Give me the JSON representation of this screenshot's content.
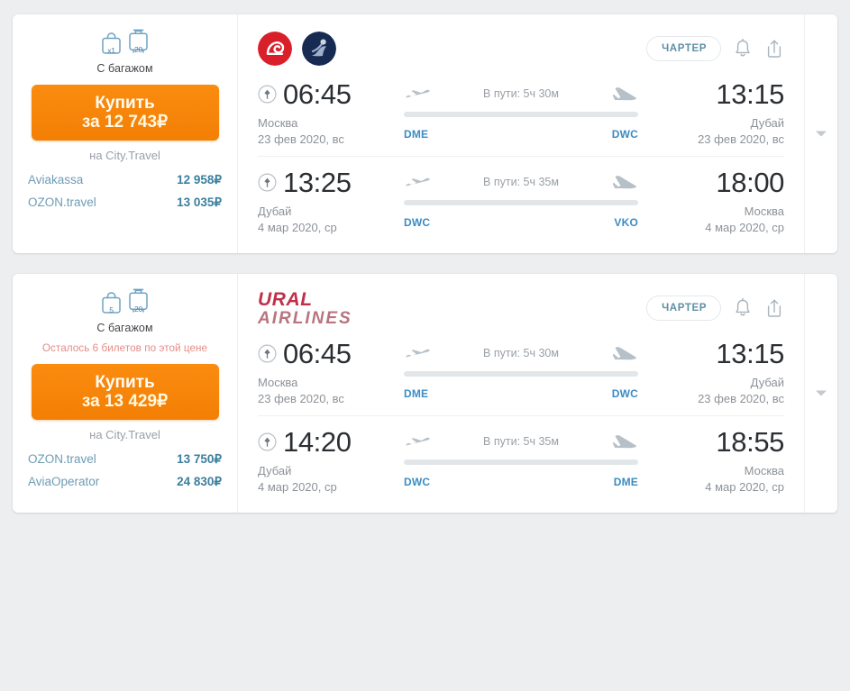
{
  "cards": [
    {
      "baggage": {
        "handbag_label": "x1",
        "suitcase_label": "20",
        "caption": "С багажом"
      },
      "tickets_left": "",
      "buy": {
        "line1": "Купить",
        "line2": "за 12 743₽",
        "sub": "на City.Travel"
      },
      "agencies": [
        {
          "name": "Aviakassa",
          "price": "12 958₽"
        },
        {
          "name": "OZON.travel",
          "price": "13 035₽"
        }
      ],
      "carrier": {
        "type": "circles",
        "logo1_name": "nordwind-airlines-logo",
        "logo2_name": "ikar-airlines-logo"
      },
      "badge": "ЧАРТЕР",
      "segments": [
        {
          "dep_time": "06:45",
          "dep_city": "Москва",
          "dep_date": "23 фев 2020, вс",
          "dep_code": "DME",
          "duration": "В пути: 5ч 30м",
          "arr_time": "13:15",
          "arr_city": "Дубай",
          "arr_date": "23 фев 2020, вс",
          "arr_code": "DWC"
        },
        {
          "dep_time": "13:25",
          "dep_city": "Дубай",
          "dep_date": "4 мар 2020, ср",
          "dep_code": "DWC",
          "duration": "В пути: 5ч 35м",
          "arr_time": "18:00",
          "arr_city": "Москва",
          "arr_date": "4 мар 2020, ср",
          "arr_code": "VKO"
        }
      ]
    },
    {
      "baggage": {
        "handbag_label": "5",
        "suitcase_label": "20",
        "caption": "С багажом"
      },
      "tickets_left": "Осталось 6 билетов по этой цене",
      "buy": {
        "line1": "Купить",
        "line2": "за 13 429₽",
        "sub": "на City.Travel"
      },
      "agencies": [
        {
          "name": "OZON.travel",
          "price": "13 750₽"
        },
        {
          "name": "AviaOperator",
          "price": "24 830₽"
        }
      ],
      "carrier": {
        "type": "ural",
        "ural_line1": "URAL",
        "ural_line2": "AIRLINES"
      },
      "badge": "ЧАРТЕР",
      "segments": [
        {
          "dep_time": "06:45",
          "dep_city": "Москва",
          "dep_date": "23 фев 2020, вс",
          "dep_code": "DME",
          "duration": "В пути: 5ч 30м",
          "arr_time": "13:15",
          "arr_city": "Дубай",
          "arr_date": "23 фев 2020, вс",
          "arr_code": "DWC"
        },
        {
          "dep_time": "14:20",
          "dep_city": "Дубай",
          "dep_date": "4 мар 2020, ср",
          "dep_code": "DWC",
          "duration": "В пути: 5ч 35м",
          "arr_time": "18:55",
          "arr_city": "Москва",
          "arr_date": "4 мар 2020, ср",
          "arr_code": "DME"
        }
      ]
    }
  ],
  "icons": {
    "bell": "notification-bell",
    "share": "share",
    "expand": "chevron-down",
    "departure": "plane-takeoff",
    "arrival": "plane-landing",
    "pin": "pin-circle"
  },
  "colors": {
    "buy_button": "#f58410",
    "airport_code": "#3b8cc4",
    "agency_price": "#3b7f9e",
    "warning": "#e38d86"
  }
}
